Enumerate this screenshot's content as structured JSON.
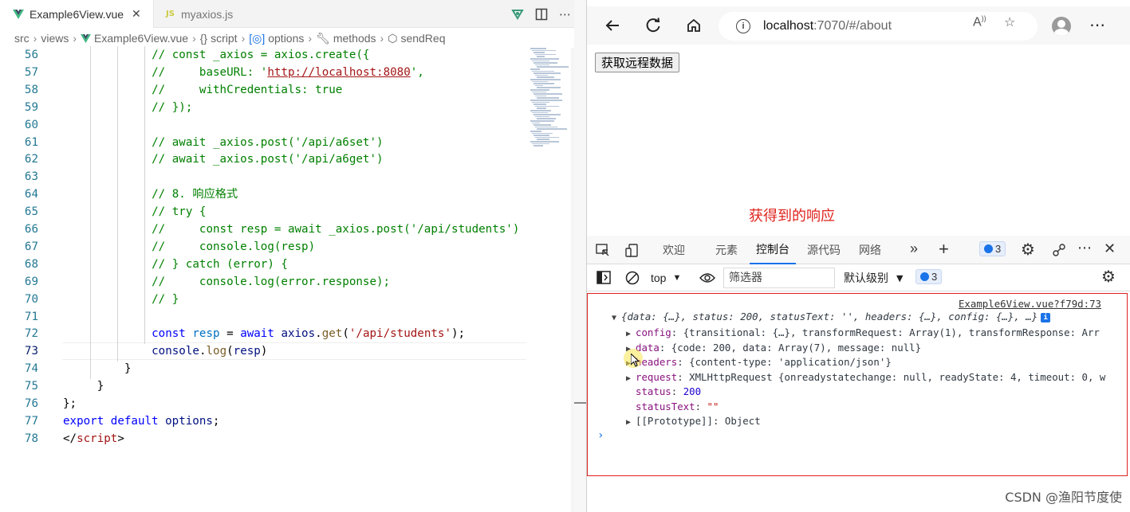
{
  "editor": {
    "tabs": [
      {
        "label": "Example6View.vue",
        "close": "✕"
      },
      {
        "label": "myaxios.js",
        "prefix": "JS"
      }
    ],
    "breadcrumb": [
      "src",
      "views",
      "Example6View.vue",
      "script",
      "options",
      "methods",
      "sendReq"
    ],
    "lines": [
      {
        "n": "56",
        "indent": 13,
        "parts": [
          {
            "c": "comment",
            "t": "// const _axios = axios.create({"
          }
        ]
      },
      {
        "n": "57",
        "indent": 13,
        "parts": [
          {
            "c": "comment",
            "t": "//     baseURL: '"
          },
          {
            "c": "link",
            "t": "http://localhost:8080"
          },
          {
            "c": "comment",
            "t": "',"
          }
        ]
      },
      {
        "n": "58",
        "indent": 13,
        "parts": [
          {
            "c": "comment",
            "t": "//     withCredentials: true"
          }
        ]
      },
      {
        "n": "59",
        "indent": 13,
        "parts": [
          {
            "c": "comment",
            "t": "// });"
          }
        ]
      },
      {
        "n": "60",
        "indent": 0,
        "parts": []
      },
      {
        "n": "61",
        "indent": 13,
        "parts": [
          {
            "c": "comment",
            "t": "// await _axios.post('/api/a6set')"
          }
        ]
      },
      {
        "n": "62",
        "indent": 13,
        "parts": [
          {
            "c": "comment",
            "t": "// await _axios.post('/api/a6get')"
          }
        ]
      },
      {
        "n": "63",
        "indent": 0,
        "parts": []
      },
      {
        "n": "64",
        "indent": 13,
        "parts": [
          {
            "c": "comment",
            "t": "// 8. 响应格式"
          }
        ]
      },
      {
        "n": "65",
        "indent": 13,
        "parts": [
          {
            "c": "comment",
            "t": "// try {"
          }
        ]
      },
      {
        "n": "66",
        "indent": 13,
        "parts": [
          {
            "c": "comment",
            "t": "//     const resp = await _axios.post('/api/students')"
          }
        ]
      },
      {
        "n": "67",
        "indent": 13,
        "parts": [
          {
            "c": "comment",
            "t": "//     console.log(resp)"
          }
        ]
      },
      {
        "n": "68",
        "indent": 13,
        "parts": [
          {
            "c": "comment",
            "t": "// } catch (error) {"
          }
        ]
      },
      {
        "n": "69",
        "indent": 13,
        "parts": [
          {
            "c": "comment",
            "t": "//     console.log(error.response);"
          }
        ]
      },
      {
        "n": "70",
        "indent": 13,
        "parts": [
          {
            "c": "comment",
            "t": "// }"
          }
        ]
      },
      {
        "n": "71",
        "indent": 0,
        "parts": []
      },
      {
        "n": "72",
        "indent": 13,
        "parts": [
          {
            "c": "keyword",
            "t": "const "
          },
          {
            "c": "const",
            "t": "resp"
          },
          {
            "c": "plain",
            "t": " = "
          },
          {
            "c": "keyword",
            "t": "await "
          },
          {
            "c": "var",
            "t": "axios"
          },
          {
            "c": "plain",
            "t": "."
          },
          {
            "c": "fn",
            "t": "get"
          },
          {
            "c": "plain",
            "t": "("
          },
          {
            "c": "string",
            "t": "'/api/students'"
          },
          {
            "c": "plain",
            "t": ");"
          }
        ]
      },
      {
        "n": "73",
        "indent": 13,
        "current": true,
        "parts": [
          {
            "c": "var",
            "t": "console"
          },
          {
            "c": "plain",
            "t": "."
          },
          {
            "c": "fn",
            "t": "log"
          },
          {
            "c": "plain",
            "t": "("
          },
          {
            "c": "var",
            "t": "resp"
          },
          {
            "c": "plain",
            "t": ")"
          }
        ]
      },
      {
        "n": "74",
        "indent": 9,
        "parts": [
          {
            "c": "plain",
            "t": "}"
          }
        ]
      },
      {
        "n": "75",
        "indent": 5,
        "parts": [
          {
            "c": "plain",
            "t": "}"
          }
        ]
      },
      {
        "n": "76",
        "indent": 0,
        "parts": [
          {
            "c": "plain",
            "t": "};"
          }
        ]
      },
      {
        "n": "77",
        "indent": 0,
        "parts": [
          {
            "c": "keyword",
            "t": "export default "
          },
          {
            "c": "var",
            "t": "options"
          },
          {
            "c": "plain",
            "t": ";"
          }
        ]
      },
      {
        "n": "78",
        "indent": 0,
        "parts": [
          {
            "c": "plain",
            "t": "</"
          },
          {
            "c": "string",
            "t": "script"
          },
          {
            "c": "plain",
            "t": ">"
          }
        ]
      }
    ]
  },
  "browser": {
    "url_host": "localhost",
    "url_path": ":7070/#/about",
    "page": {
      "fetch_button": "获取远程数据",
      "annotation": "获得到的响应"
    },
    "devtools": {
      "tabs": [
        "欢迎",
        "元素",
        "控制台",
        "源代码",
        "网络"
      ],
      "active_tab": "控制台",
      "issue_count": "3",
      "context": "top",
      "filter_placeholder": "筛选器",
      "level": "默认级别",
      "message_count": "3",
      "source_link": "Example6View.vue?f79d:73",
      "summary": "{data: {…}, status: 200, statusText: '', headers: {…}, config: {…}, …}",
      "rows": [
        {
          "key": "config",
          "expand": true,
          "value": "{transitional: {…}, transformRequest: Array(1), transformResponse: Arr"
        },
        {
          "key": "data",
          "expand": true,
          "value": "{code: 200, data: Array(7), message: null}"
        },
        {
          "key": "headers",
          "expand": true,
          "value": "{content-type: 'application/json'}"
        },
        {
          "key": "request",
          "expand": true,
          "value": "XMLHttpRequest {onreadystatechange: null, readyState: 4, timeout: 0, w"
        },
        {
          "key": "status",
          "expand": false,
          "value": "200"
        },
        {
          "key": "statusText",
          "expand": false,
          "value": "\"\""
        },
        {
          "key": "[[Prototype]]",
          "expand": true,
          "value": "Object"
        }
      ]
    }
  },
  "watermark": "CSDN @渔阳节度使",
  "colors": {
    "accent": "#1a73e8",
    "annotation": "#e0231d",
    "console_border": "#e02020"
  }
}
